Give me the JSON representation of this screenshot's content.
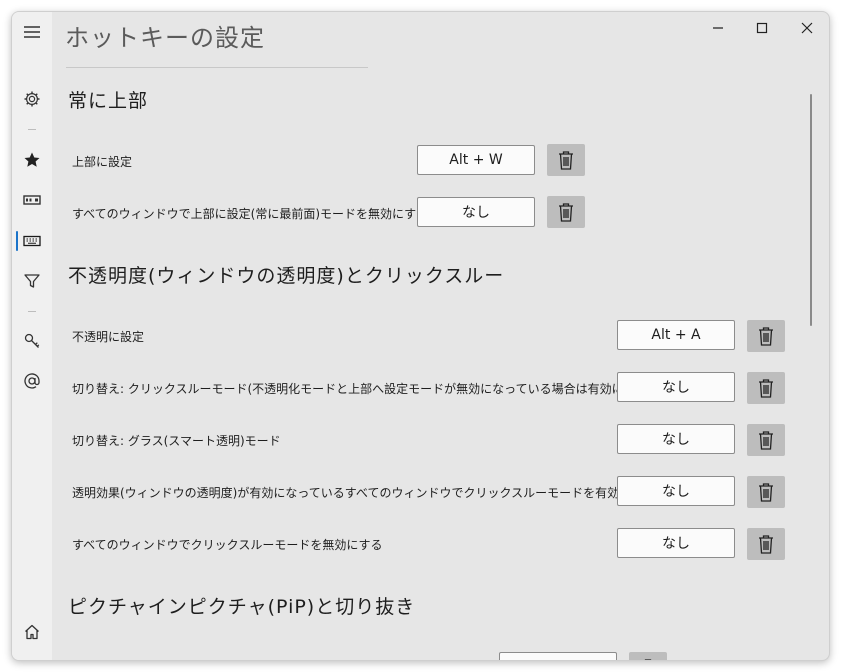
{
  "window": {
    "title": "ホットキーの設定",
    "controls": {
      "minimize_icon": "minimize-icon",
      "maximize_icon": "maximize-icon",
      "close_icon": "close-icon"
    }
  },
  "sidebar": {
    "items": [
      {
        "name": "menu",
        "icon": "hamburger-icon"
      },
      {
        "name": "settings",
        "icon": "gear-icon"
      },
      {
        "name": "favorites",
        "icon": "star-icon"
      },
      {
        "name": "window",
        "icon": "titlebar-icon"
      },
      {
        "name": "hotkeys",
        "icon": "keyboard-icon",
        "active": true
      },
      {
        "name": "filter",
        "icon": "filter-icon"
      },
      {
        "name": "key",
        "icon": "key-icon"
      },
      {
        "name": "contact",
        "icon": "at-icon"
      },
      {
        "name": "home",
        "icon": "home-icon"
      }
    ],
    "accent_color": "#1a73c9"
  },
  "sections": {
    "always_on_top": {
      "heading": "常に上部",
      "rows": [
        {
          "label": "上部に設定",
          "value": "Alt + W"
        },
        {
          "label": "すべてのウィンドウで上部に設定(常に最前面)モードを無効にする",
          "value": "なし"
        }
      ]
    },
    "opacity": {
      "heading": "不透明度(ウィンドウの透明度)とクリックスルー",
      "rows": [
        {
          "label": "不透明に設定",
          "value": "Alt + A"
        },
        {
          "label": "切り替え: クリックスルーモード(不透明化モードと上部へ設定モードが無効になっている場合は有効になります)",
          "value": "なし"
        },
        {
          "label": "切り替え: グラス(スマート透明)モード",
          "value": "なし"
        },
        {
          "label": "透明効果(ウィンドウの透明度)が有効になっているすべてのウィンドウでクリックスルーモードを有効にする",
          "value": "なし"
        },
        {
          "label": "すべてのウィンドウでクリックスルーモードを無効にする",
          "value": "なし"
        }
      ]
    },
    "pip": {
      "heading": "ピクチャインピクチャ(PiP)と切り抜き"
    }
  }
}
